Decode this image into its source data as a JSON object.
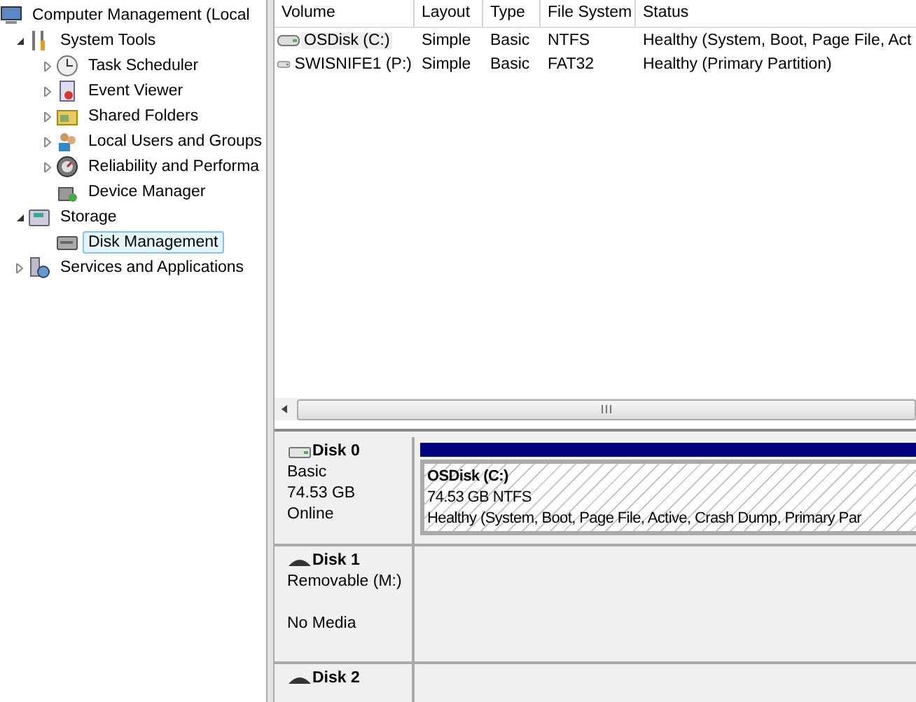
{
  "tree": [
    {
      "label": "Computer Management (Local",
      "selected": false,
      "children": [
        {
          "label": "System Tools",
          "kind": "folder",
          "expanded": true,
          "selected": false,
          "children": [
            {
              "label": "Task Scheduler",
              "kind": "folder",
              "expanded": false,
              "selected": false
            },
            {
              "label": "Event Viewer",
              "kind": "folder",
              "expanded": false,
              "selected": false
            },
            {
              "label": "Shared Folders",
              "kind": "folder",
              "expanded": false,
              "selected": false
            },
            {
              "label": "Local Users and Groups",
              "kind": "folder",
              "expanded": false,
              "selected": false
            },
            {
              "label": "Reliability and Performa",
              "kind": "folder",
              "expanded": false,
              "selected": false
            },
            {
              "label": "Device Manager",
              "kind": "leaf",
              "selected": false
            }
          ]
        },
        {
          "label": "Storage",
          "kind": "folder",
          "expanded": true,
          "selected": false,
          "children": [
            {
              "label": "Disk Management",
              "kind": "leaf",
              "selected": true
            }
          ]
        },
        {
          "label": "Services and Applications",
          "kind": "folder",
          "expanded": false,
          "selected": false
        }
      ]
    }
  ],
  "table": {
    "columns": [
      "Volume",
      "Layout",
      "Type",
      "File System",
      "Status"
    ],
    "rows": [
      {
        "selected": true,
        "cells": [
          "OSDisk (C:)",
          "Simple",
          "Basic",
          "NTFS",
          "Healthy (System, Boot, Page File, Act"
        ]
      },
      {
        "selected": false,
        "cells": [
          "SWISNIFE1 (P:)",
          "Simple",
          "Basic",
          "FAT32",
          "Healthy (Primary Partition)"
        ]
      }
    ]
  },
  "disks": [
    {
      "name": "Disk 0",
      "kind": "fixed",
      "type": "Basic",
      "size": "74.53 GB",
      "status": "Online",
      "partitions": [
        {
          "name": "OSDisk  (C:)",
          "size": "74.53 GB NTFS",
          "status": "Healthy (System, Boot, Page File, Active, Crash Dump, Primary Par",
          "color": "#000080"
        }
      ]
    },
    {
      "name": "Disk 1",
      "kind": "removable",
      "type": "Removable (M:)",
      "status": "No Media"
    },
    {
      "name": "Disk 2",
      "kind": "removable"
    }
  ]
}
